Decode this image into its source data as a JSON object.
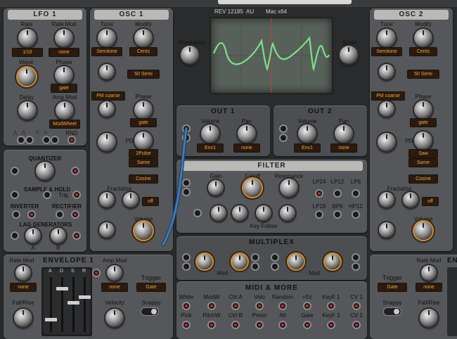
{
  "header": {
    "build": "REV 12185",
    "format": "AU",
    "platform": "Mac x64"
  },
  "add_label": "+",
  "lfo": {
    "title": "LFO 1",
    "rate": "Rate",
    "rate_mod": "Rate Mod",
    "rate_val": "1/16",
    "rate_mod_val": "none",
    "wave": "Wave",
    "phase": "Phase",
    "phase_val": "gate",
    "delay": "Delay",
    "amp_mod": "Amp Mod",
    "amp_mod_val": "ModWheel",
    "rnd": "RND"
  },
  "util": {
    "quantizer": "QUANTIZER",
    "sample_hold": "SAMPLE & HOLD",
    "trig": "Trig.",
    "inverter": "INVERTER",
    "rectifier": "RECTIFIER",
    "lag": "LAG GENERATORS",
    "a": "A",
    "r": "R"
  },
  "osc1": {
    "title": "OSC 1",
    "tune": "Tune",
    "modify": "Modify",
    "tune_val": "Semitone",
    "modify_val": "Cents",
    "semi_val": "50 Semi",
    "pm_val": "PM coarse",
    "phase": "Phase",
    "phase_val": "gate",
    "pd": "PD",
    "pd_val": "2Pulse",
    "same": "Same",
    "cosine": "Cosine",
    "fractalize": "Fractalize",
    "frac_val": "off",
    "volume": "Volume"
  },
  "osc2": {
    "title": "OSC 2",
    "tune": "Tune",
    "modify": "Modify",
    "tune_val": "Semitone",
    "modify_val": "Cents",
    "semi_val": "50 Semi",
    "pm_val": "PM coarse",
    "phase": "Phase",
    "phase_val": "gate",
    "pd": "PD",
    "pd_val": "Saw",
    "same": "Same",
    "cosine": "Cosine",
    "fractalize": "Fractalize",
    "frac_val": "off",
    "volume": "Volume"
  },
  "scope": {
    "frequency": "Frequency",
    "scale": "Scale"
  },
  "out1": {
    "title": "OUT 1",
    "volume": "Volume",
    "pan": "Pan",
    "vol_val": "Env1",
    "pan_val": "none"
  },
  "out2": {
    "title": "OUT 2",
    "volume": "Volume",
    "pan": "Pan",
    "vol_val": "Env1",
    "pan_val": "none"
  },
  "filter": {
    "title": "FILTER",
    "gain": "Gain",
    "cutoff": "Cutoff",
    "resonance": "Resonance",
    "key_follow": "Key Follow",
    "modes": [
      "LP24",
      "LP12",
      "LP6",
      "LP18",
      "BP6",
      "HP12"
    ]
  },
  "multiplex": {
    "title": "MULTIPLEX",
    "mod": "Mod"
  },
  "midi": {
    "title": "MIDI & MORE",
    "row1": [
      "White",
      "ModW",
      "Ctrl A",
      "Velo",
      "Random",
      "+5V",
      "KeyF 1",
      "CV 1"
    ],
    "row2": [
      "Pink",
      "PitchW",
      "Ctrl B",
      "Press",
      "Alt",
      "Gate",
      "KeyF 2",
      "CV 2"
    ]
  },
  "env1": {
    "title": "ENVELOPE 1",
    "rate_mod": "Rate Mod",
    "rate_mod_val": "none",
    "fall_rise": "Fall/Rise",
    "amp_mod": "Amp Mod",
    "amp_mod_val": "none",
    "trigger": "Trigger",
    "trigger_val": "Gate",
    "velocity": "Velocity",
    "snappy": "Snappy",
    "sliders": [
      "A",
      "D",
      "S",
      "R"
    ]
  },
  "env2": {
    "trigger": "Trigger",
    "trigger_val": "Gate",
    "rate_mod": "Rate Mod",
    "rate_mod_val": "none",
    "snappy": "Snappy",
    "fall_rise": "Fall/Rise",
    "title_partial": "EN"
  },
  "colors": {
    "panel": "#55575a",
    "display_bg": "#2c1a0c",
    "display_text": "#e8a84a",
    "accent_orange": "#e08a1e",
    "scope_wave": "#7be08a",
    "cable": "#3c7ab8"
  }
}
